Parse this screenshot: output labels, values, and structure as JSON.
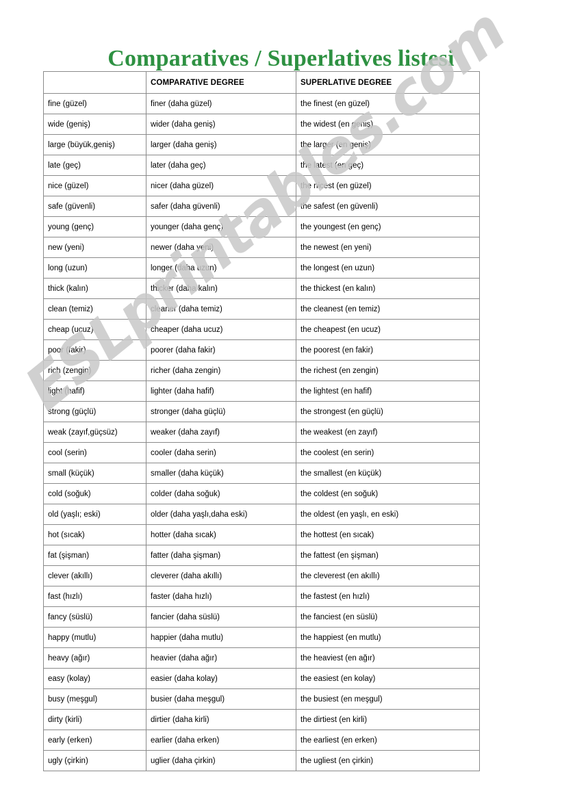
{
  "title": "Comparatives / Superlatives listesi",
  "watermark": "ESLprintables.com",
  "colors": {
    "title_green": "#2e9142",
    "border_gray": "#8a8a8a",
    "watermark_gray": "#c8c8c8",
    "text_black": "#000000"
  },
  "table": {
    "headers": [
      "",
      "COMPARATIVE DEGREE",
      "SUPERLATIVE DEGREE"
    ],
    "rows": [
      [
        "fine (güzel)",
        "finer (daha güzel)",
        "the finest (en güzel)"
      ],
      [
        "wide (geniş)",
        "wider (daha geniş)",
        "the widest (en geniş)"
      ],
      [
        "large (büyük,geniş)",
        "larger (daha geniş)",
        "the larger (en geniş)"
      ],
      [
        "late (geç)",
        "later (daha geç)",
        "the latest (en geç)"
      ],
      [
        "nice (güzel)",
        "nicer (daha güzel)",
        "the nicest (en güzel)"
      ],
      [
        "safe (güvenli)",
        "safer (daha güvenli)",
        "the safest (en güvenli)"
      ],
      [
        "young (genç)",
        "younger (daha genç)",
        "the youngest (en genç)"
      ],
      [
        "new (yeni)",
        "newer (daha yeni)",
        "the newest (en yeni)"
      ],
      [
        "long (uzun)",
        "longer (daha uzun)",
        "the longest (en uzun)"
      ],
      [
        "thick (kalın)",
        "thicker (daha kalın)",
        "the thickest (en kalın)"
      ],
      [
        "clean (temiz)",
        "cleaner (daha temiz)",
        "the cleanest (en temiz)"
      ],
      [
        "cheap (ucuz)",
        "cheaper (daha ucuz)",
        "the cheapest (en ucuz)"
      ],
      [
        "poor (fakir)",
        "poorer (daha fakir)",
        "the poorest (en fakir)"
      ],
      [
        "rich (zengin)",
        "richer (daha zengin)",
        "the richest (en zengin)"
      ],
      [
        "light (hafif)",
        "lighter (daha hafif)",
        "the lightest (en hafif)"
      ],
      [
        "strong (güçlü)",
        "stronger (daha güçlü)",
        "the strongest (en güçlü)"
      ],
      [
        "weak (zayıf,güçsüz)",
        "weaker (daha zayıf)",
        "the weakest (en zayıf)"
      ],
      [
        "cool (serin)",
        "cooler (daha serin)",
        "the coolest (en serin)"
      ],
      [
        "small (küçük)",
        "smaller (daha küçük)",
        "the smallest (en küçük)"
      ],
      [
        "cold (soğuk)",
        "colder (daha soğuk)",
        "the coldest (en soğuk)"
      ],
      [
        "old (yaşlı; eski)",
        "older (daha yaşlı,daha eski)",
        "the oldest (en yaşlı, en eski)"
      ],
      [
        "hot (sıcak)",
        "hotter (daha sıcak)",
        "the hottest (en sıcak)"
      ],
      [
        "fat (şişman)",
        "fatter (daha şişman)",
        "the fattest (en şişman)"
      ],
      [
        "clever (akıllı)",
        "cleverer (daha akıllı)",
        "the cleverest (en akıllı)"
      ],
      [
        "fast (hızlı)",
        "faster (daha hızlı)",
        "the fastest (en hızlı)"
      ],
      [
        "fancy (süslü)",
        "fancier (daha süslü)",
        "the fanciest (en süslü)"
      ],
      [
        "happy (mutlu)",
        "happier (daha mutlu)",
        "the happiest (en mutlu)"
      ],
      [
        "heavy (ağır)",
        "heavier (daha ağır)",
        "the heaviest (en ağır)"
      ],
      [
        "easy (kolay)",
        "easier (daha kolay)",
        "the easiest (en kolay)"
      ],
      [
        "busy (meşgul)",
        "busier (daha meşgul)",
        "the busiest (en meşgul)"
      ],
      [
        "dirty (kirli)",
        "dirtier (daha kirli)",
        "the dirtiest (en kirli)"
      ],
      [
        "early (erken)",
        "earlier (daha erken)",
        "the earliest (en erken)"
      ],
      [
        "ugly (çirkin)",
        "uglier (daha çirkin)",
        "the ugliest (en çirkin)"
      ]
    ]
  }
}
